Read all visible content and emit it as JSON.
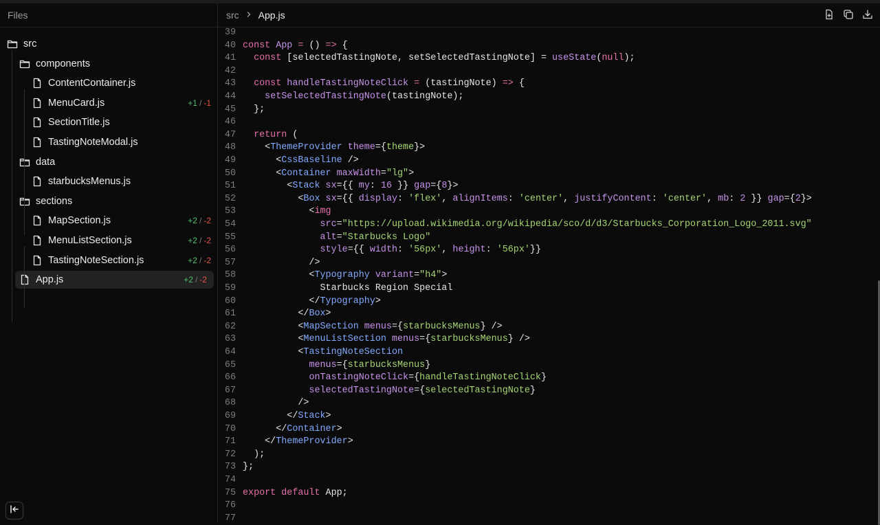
{
  "sidebar": {
    "title": "Files",
    "tree": [
      {
        "label": "src",
        "type": "folder",
        "depth": 0
      },
      {
        "label": "components",
        "type": "folder",
        "depth": 1
      },
      {
        "label": "ContentContainer.js",
        "type": "file",
        "depth": 2
      },
      {
        "label": "MenuCard.js",
        "type": "file",
        "depth": 2,
        "added": "+1",
        "removed": "-1"
      },
      {
        "label": "SectionTitle.js",
        "type": "file",
        "depth": 2
      },
      {
        "label": "TastingNoteModal.js",
        "type": "file",
        "depth": 2
      },
      {
        "label": "data",
        "type": "folder",
        "depth": 1
      },
      {
        "label": "starbucksMenus.js",
        "type": "file",
        "depth": 2
      },
      {
        "label": "sections",
        "type": "folder",
        "depth": 1
      },
      {
        "label": "MapSection.js",
        "type": "file",
        "depth": 2,
        "added": "+2",
        "removed": "-2"
      },
      {
        "label": "MenuListSection.js",
        "type": "file",
        "depth": 2,
        "added": "+2",
        "removed": "-2"
      },
      {
        "label": "TastingNoteSection.js",
        "type": "file",
        "depth": 2,
        "added": "+2",
        "removed": "-2"
      },
      {
        "label": "App.js",
        "type": "file",
        "depth": 1,
        "added": "+2",
        "removed": "-2",
        "selected": true
      }
    ]
  },
  "editor": {
    "breadcrumb": {
      "folder": "src",
      "file": "App.js"
    },
    "actions": [
      "new-file-icon",
      "copy-icon",
      "download-icon"
    ],
    "lines": [
      {
        "n": "39",
        "t": []
      },
      {
        "n": "40",
        "t": [
          [
            "k",
            "const "
          ],
          [
            "v",
            "App"
          ],
          [
            "k",
            " = "
          ],
          [
            "p",
            "() "
          ],
          [
            "k",
            "=>"
          ],
          [
            "p",
            " {"
          ]
        ]
      },
      {
        "n": "41",
        "t": [
          [
            "p",
            "  "
          ],
          [
            "k",
            "const"
          ],
          [
            "p",
            " [selectedTastingNote, setSelectedTastingNote] = "
          ],
          [
            "f",
            "useState"
          ],
          [
            "p",
            "("
          ],
          [
            "k",
            "null"
          ],
          [
            "p",
            ");"
          ]
        ]
      },
      {
        "n": "42",
        "t": []
      },
      {
        "n": "43",
        "t": [
          [
            "p",
            "  "
          ],
          [
            "k",
            "const "
          ],
          [
            "v",
            "handleTastingNoteClick"
          ],
          [
            "k",
            " = "
          ],
          [
            "p",
            "(tastingNote) "
          ],
          [
            "k",
            "=>"
          ],
          [
            "p",
            " {"
          ]
        ]
      },
      {
        "n": "44",
        "t": [
          [
            "p",
            "    "
          ],
          [
            "f",
            "setSelectedTastingNote"
          ],
          [
            "p",
            "(tastingNote);"
          ]
        ]
      },
      {
        "n": "45",
        "t": [
          [
            "p",
            "  };"
          ]
        ]
      },
      {
        "n": "46",
        "t": []
      },
      {
        "n": "47",
        "t": [
          [
            "p",
            "  "
          ],
          [
            "k",
            "return"
          ],
          [
            "p",
            " ("
          ]
        ]
      },
      {
        "n": "48",
        "t": [
          [
            "p",
            "    <"
          ],
          [
            "t",
            "ThemeProvider"
          ],
          [
            "a",
            " theme"
          ],
          [
            "p",
            "={"
          ],
          [
            "e",
            "theme"
          ],
          [
            "p",
            "}>"
          ]
        ]
      },
      {
        "n": "49",
        "t": [
          [
            "p",
            "      <"
          ],
          [
            "t",
            "CssBaseline"
          ],
          [
            "p",
            " />"
          ]
        ]
      },
      {
        "n": "50",
        "t": [
          [
            "p",
            "      <"
          ],
          [
            "t",
            "Container"
          ],
          [
            "a",
            " maxWidth"
          ],
          [
            "p",
            "="
          ],
          [
            "s",
            "\"lg\""
          ],
          [
            "p",
            ">"
          ]
        ]
      },
      {
        "n": "51",
        "t": [
          [
            "p",
            "        <"
          ],
          [
            "t",
            "Stack"
          ],
          [
            "a",
            " sx"
          ],
          [
            "p",
            "={{ "
          ],
          [
            "a",
            "my"
          ],
          [
            "p",
            ": "
          ],
          [
            "n",
            "16"
          ],
          [
            "p",
            " }} "
          ],
          [
            "a",
            "gap"
          ],
          [
            "p",
            "={"
          ],
          [
            "n",
            "8"
          ],
          [
            "p",
            "}>"
          ]
        ]
      },
      {
        "n": "52",
        "t": [
          [
            "p",
            "          <"
          ],
          [
            "t",
            "Box"
          ],
          [
            "a",
            " sx"
          ],
          [
            "p",
            "={{ "
          ],
          [
            "a",
            "display"
          ],
          [
            "p",
            ": "
          ],
          [
            "s",
            "'flex'"
          ],
          [
            "p",
            ", "
          ],
          [
            "a",
            "alignItems"
          ],
          [
            "p",
            ": "
          ],
          [
            "s",
            "'center'"
          ],
          [
            "p",
            ", "
          ],
          [
            "a",
            "justifyContent"
          ],
          [
            "p",
            ": "
          ],
          [
            "s",
            "'center'"
          ],
          [
            "p",
            ", "
          ],
          [
            "a",
            "mb"
          ],
          [
            "p",
            ": "
          ],
          [
            "n",
            "2"
          ],
          [
            "p",
            " }} "
          ],
          [
            "a",
            "gap"
          ],
          [
            "p",
            "={"
          ],
          [
            "n",
            "2"
          ],
          [
            "p",
            "}>"
          ]
        ]
      },
      {
        "n": "53",
        "t": [
          [
            "p",
            "            <"
          ],
          [
            "k",
            "img"
          ]
        ]
      },
      {
        "n": "54",
        "t": [
          [
            "p",
            "              "
          ],
          [
            "a",
            "src"
          ],
          [
            "p",
            "="
          ],
          [
            "s",
            "\"https://upload.wikimedia.org/wikipedia/sco/d/d3/Starbucks_Corporation_Logo_2011.svg\""
          ]
        ]
      },
      {
        "n": "55",
        "t": [
          [
            "p",
            "              "
          ],
          [
            "a",
            "alt"
          ],
          [
            "p",
            "="
          ],
          [
            "s",
            "\"Starbucks Logo\""
          ]
        ]
      },
      {
        "n": "56",
        "t": [
          [
            "p",
            "              "
          ],
          [
            "a",
            "style"
          ],
          [
            "p",
            "={{ "
          ],
          [
            "a",
            "width"
          ],
          [
            "p",
            ": "
          ],
          [
            "s",
            "'56px'"
          ],
          [
            "p",
            ", "
          ],
          [
            "a",
            "height"
          ],
          [
            "p",
            ": "
          ],
          [
            "s",
            "'56px'"
          ],
          [
            "p",
            "}}"
          ]
        ]
      },
      {
        "n": "57",
        "t": [
          [
            "p",
            "            />"
          ]
        ]
      },
      {
        "n": "58",
        "t": [
          [
            "p",
            "            <"
          ],
          [
            "t",
            "Typography"
          ],
          [
            "a",
            " variant"
          ],
          [
            "p",
            "="
          ],
          [
            "s",
            "\"h4\""
          ],
          [
            "p",
            ">"
          ]
        ]
      },
      {
        "n": "59",
        "t": [
          [
            "w",
            "              Starbucks Region Special"
          ]
        ]
      },
      {
        "n": "60",
        "t": [
          [
            "p",
            "            </"
          ],
          [
            "t",
            "Typography"
          ],
          [
            "p",
            ">"
          ]
        ]
      },
      {
        "n": "61",
        "t": [
          [
            "p",
            "          </"
          ],
          [
            "t",
            "Box"
          ],
          [
            "p",
            ">"
          ]
        ]
      },
      {
        "n": "62",
        "t": [
          [
            "p",
            "          <"
          ],
          [
            "t",
            "MapSection"
          ],
          [
            "a",
            " menus"
          ],
          [
            "p",
            "={"
          ],
          [
            "e",
            "starbucksMenus"
          ],
          [
            "p",
            "} />"
          ]
        ]
      },
      {
        "n": "63",
        "t": [
          [
            "p",
            "          <"
          ],
          [
            "t",
            "MenuListSection"
          ],
          [
            "a",
            " menus"
          ],
          [
            "p",
            "={"
          ],
          [
            "e",
            "starbucksMenus"
          ],
          [
            "p",
            "} />"
          ]
        ]
      },
      {
        "n": "64",
        "t": [
          [
            "p",
            "          <"
          ],
          [
            "t",
            "TastingNoteSection"
          ]
        ]
      },
      {
        "n": "65",
        "t": [
          [
            "p",
            "            "
          ],
          [
            "a",
            "menus"
          ],
          [
            "p",
            "={"
          ],
          [
            "e",
            "starbucksMenus"
          ],
          [
            "p",
            "}"
          ]
        ]
      },
      {
        "n": "66",
        "t": [
          [
            "p",
            "            "
          ],
          [
            "a",
            "onTastingNoteClick"
          ],
          [
            "p",
            "={"
          ],
          [
            "e",
            "handleTastingNoteClick"
          ],
          [
            "p",
            "}"
          ]
        ]
      },
      {
        "n": "67",
        "t": [
          [
            "p",
            "            "
          ],
          [
            "a",
            "selectedTastingNote"
          ],
          [
            "p",
            "={"
          ],
          [
            "e",
            "selectedTastingNote"
          ],
          [
            "p",
            "}"
          ]
        ]
      },
      {
        "n": "68",
        "t": [
          [
            "p",
            "          />"
          ]
        ]
      },
      {
        "n": "69",
        "t": [
          [
            "p",
            "        </"
          ],
          [
            "t",
            "Stack"
          ],
          [
            "p",
            ">"
          ]
        ]
      },
      {
        "n": "70",
        "t": [
          [
            "p",
            "      </"
          ],
          [
            "t",
            "Container"
          ],
          [
            "p",
            ">"
          ]
        ]
      },
      {
        "n": "71",
        "t": [
          [
            "p",
            "    </"
          ],
          [
            "t",
            "ThemeProvider"
          ],
          [
            "p",
            ">"
          ]
        ]
      },
      {
        "n": "72",
        "t": [
          [
            "p",
            "  );"
          ]
        ]
      },
      {
        "n": "73",
        "t": [
          [
            "p",
            "};"
          ]
        ]
      },
      {
        "n": "74",
        "t": []
      },
      {
        "n": "75",
        "t": [
          [
            "k",
            "export default "
          ],
          [
            "p",
            "App;"
          ]
        ]
      },
      {
        "n": "76",
        "t": []
      },
      {
        "n": "77",
        "t": []
      }
    ]
  },
  "colors": {
    "background": "#0b0b0b",
    "added": "#4ec26b",
    "removed": "#e5534b",
    "keyword": "#e56fab",
    "tag": "#82aaff",
    "string": "#a6d675"
  }
}
